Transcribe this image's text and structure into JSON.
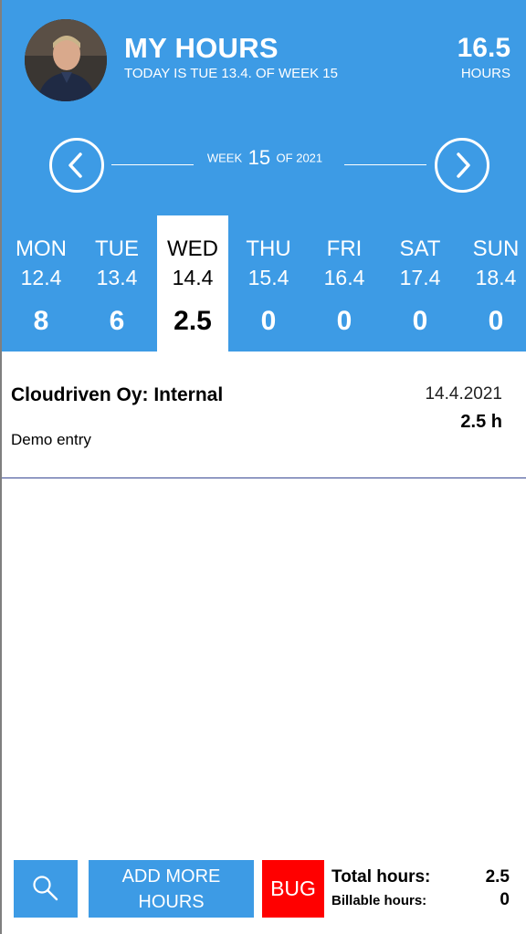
{
  "header": {
    "title": "MY HOURS",
    "subtitle": "TODAY IS TUE 13.4. OF WEEK 15",
    "total_hours": "16.5",
    "total_unit": "HOURS"
  },
  "week_nav": {
    "prefix": "WEEK",
    "week_number": "15",
    "suffix": "OF 2021"
  },
  "days": [
    {
      "name": "MON",
      "date": "12.4",
      "hours": "8"
    },
    {
      "name": "TUE",
      "date": "13.4",
      "hours": "6"
    },
    {
      "name": "WED",
      "date": "14.4",
      "hours": "2.5",
      "selected": true
    },
    {
      "name": "THU",
      "date": "15.4",
      "hours": "0"
    },
    {
      "name": "FRI",
      "date": "16.4",
      "hours": "0"
    },
    {
      "name": "SAT",
      "date": "17.4",
      "hours": "0"
    },
    {
      "name": "SUN",
      "date": "18.4",
      "hours": "0"
    }
  ],
  "entries": [
    {
      "title": "Cloudriven Oy: Internal",
      "description": "Demo entry",
      "date": "14.4.2021",
      "hours": "2.5 h"
    }
  ],
  "footer": {
    "add_label_line1": "ADD MORE",
    "add_label_line2": "HOURS",
    "bug_label": "BUG",
    "total_label": "Total hours:",
    "total_value": "2.5",
    "billable_label": "Billable hours:",
    "billable_value": "0"
  },
  "icons": {
    "prev": "chevron-left-icon",
    "next": "chevron-right-icon",
    "search": "magnifier-icon"
  },
  "colors": {
    "primary": "#3d9be5",
    "bug": "#ff0000",
    "divider": "#3a4a94"
  }
}
